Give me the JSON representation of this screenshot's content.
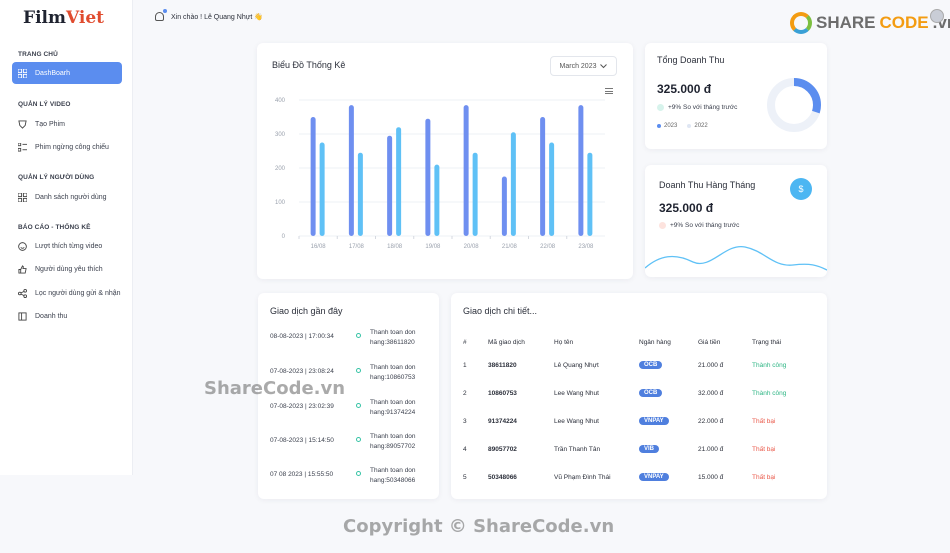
{
  "brand": {
    "name_part1": "Film",
    "name_part2": "Viet"
  },
  "header": {
    "greeting": "Xin chào ! Lê Quang Nhựt 👋"
  },
  "corner_brand": {
    "part1": "SHARE",
    "part2": "CODE",
    "part3": ".vn"
  },
  "sidebar": {
    "sections": [
      {
        "title": "TRANG CHỦ",
        "items": [
          {
            "label": "DashBoarh",
            "icon": "grid-icon",
            "active": true
          }
        ]
      },
      {
        "title": "QUẢN LÝ VIDEO",
        "items": [
          {
            "label": "Tạo Phim",
            "icon": "shield-icon"
          },
          {
            "label": "Phim ngừng công chiếu",
            "icon": "list-icon"
          }
        ]
      },
      {
        "title": "QUẢN LÝ NGƯỜI DÙNG",
        "items": [
          {
            "label": "Danh sách người dùng",
            "icon": "grid-icon"
          }
        ]
      },
      {
        "title": "BÁO CÁO - THỐNG KÊ",
        "items": [
          {
            "label": "Lượt thích từng video",
            "icon": "smile-icon"
          },
          {
            "label": "Người dùng yêu thích",
            "icon": "thumb-icon"
          },
          {
            "label": "Lọc người dùng gửi & nhận",
            "icon": "share-icon"
          },
          {
            "label": "Doanh thu",
            "icon": "book-icon"
          }
        ]
      }
    ]
  },
  "stats_chart": {
    "title": "Biểu Đồ Thống Kê",
    "month": "March 2023"
  },
  "chart_data": {
    "type": "bar",
    "title": "Biểu Đồ Thống Kê",
    "categories": [
      "16/08",
      "17/08",
      "18/08",
      "19/08",
      "20/08",
      "21/08",
      "22/08",
      "23/08"
    ],
    "yticks": [
      "0",
      "100",
      "200",
      "300",
      "400"
    ],
    "ylim": [
      0,
      400
    ],
    "series": [
      {
        "values": [
          350,
          385,
          295,
          345,
          385,
          175,
          350,
          385
        ],
        "color": "#6f8ff0"
      },
      {
        "values": [
          275,
          245,
          320,
          210,
          245,
          305,
          275,
          245
        ],
        "color": "#5fc1f6"
      }
    ]
  },
  "total_revenue": {
    "title": "Tổng Doanh Thu",
    "amount": "325.000 đ",
    "delta": "+9% So với tháng trước",
    "legend": [
      "2023",
      "2022"
    ],
    "donut_share": 0.3
  },
  "monthly_revenue": {
    "title": "Doanh Thu Hàng Tháng",
    "amount": "325.000 đ",
    "delta": "+9% So với tháng trước",
    "icon_label": "$"
  },
  "recent": {
    "title": "Giao dịch gần đây",
    "rows": [
      {
        "when": "08-08-2023 | 17:00:34",
        "line1": "Thanh toan don",
        "line2": "hang:38611820"
      },
      {
        "when": "07-08-2023 | 23:08:24",
        "line1": "Thanh toan don",
        "line2": "hang:10860753"
      },
      {
        "when": "07-08-2023 | 23:02:39",
        "line1": "Thanh toan don",
        "line2": "hang:91374224"
      },
      {
        "when": "07-08-2023 | 15:14:50",
        "line1": "Thanh toan don",
        "line2": "hang:89057702"
      },
      {
        "when": "07 08 2023 | 15:55:50",
        "line1": "Thanh toan don",
        "line2": "hang:50348066"
      }
    ]
  },
  "details": {
    "title": "Giao dịch chi tiết...",
    "headers": [
      "#",
      "Mã giao dịch",
      "Họ tên",
      "Ngân hàng",
      "Giá tiền",
      "Trạng thái"
    ],
    "rows": [
      {
        "no": "1",
        "code": "38611820",
        "name": "Lê Quang Nhựt",
        "bank": "OCB",
        "price": "21.000 đ",
        "status": "Thành công",
        "ok": true
      },
      {
        "no": "2",
        "code": "10860753",
        "name": "Lee Wang Nhut",
        "bank": "OCB",
        "price": "32.000 đ",
        "status": "Thành công",
        "ok": true
      },
      {
        "no": "3",
        "code": "91374224",
        "name": "Lee Wang Nhut",
        "bank": "VNPAY",
        "price": "22.000 đ",
        "status": "Thất bại",
        "ok": false
      },
      {
        "no": "4",
        "code": "89057702",
        "name": "Trần Thanh Tân",
        "bank": "VIB",
        "price": "21.000 đ",
        "status": "Thất bại",
        "ok": false
      },
      {
        "no": "5",
        "code": "50348066",
        "name": "Vũ Phạm Đình Thái",
        "bank": "VNPAY",
        "price": "15.000 đ",
        "status": "Thất bại",
        "ok": false
      }
    ]
  },
  "watermarks": {
    "center": "ShareCode.vn",
    "footer": "Copyright © ShareCode.vn"
  }
}
